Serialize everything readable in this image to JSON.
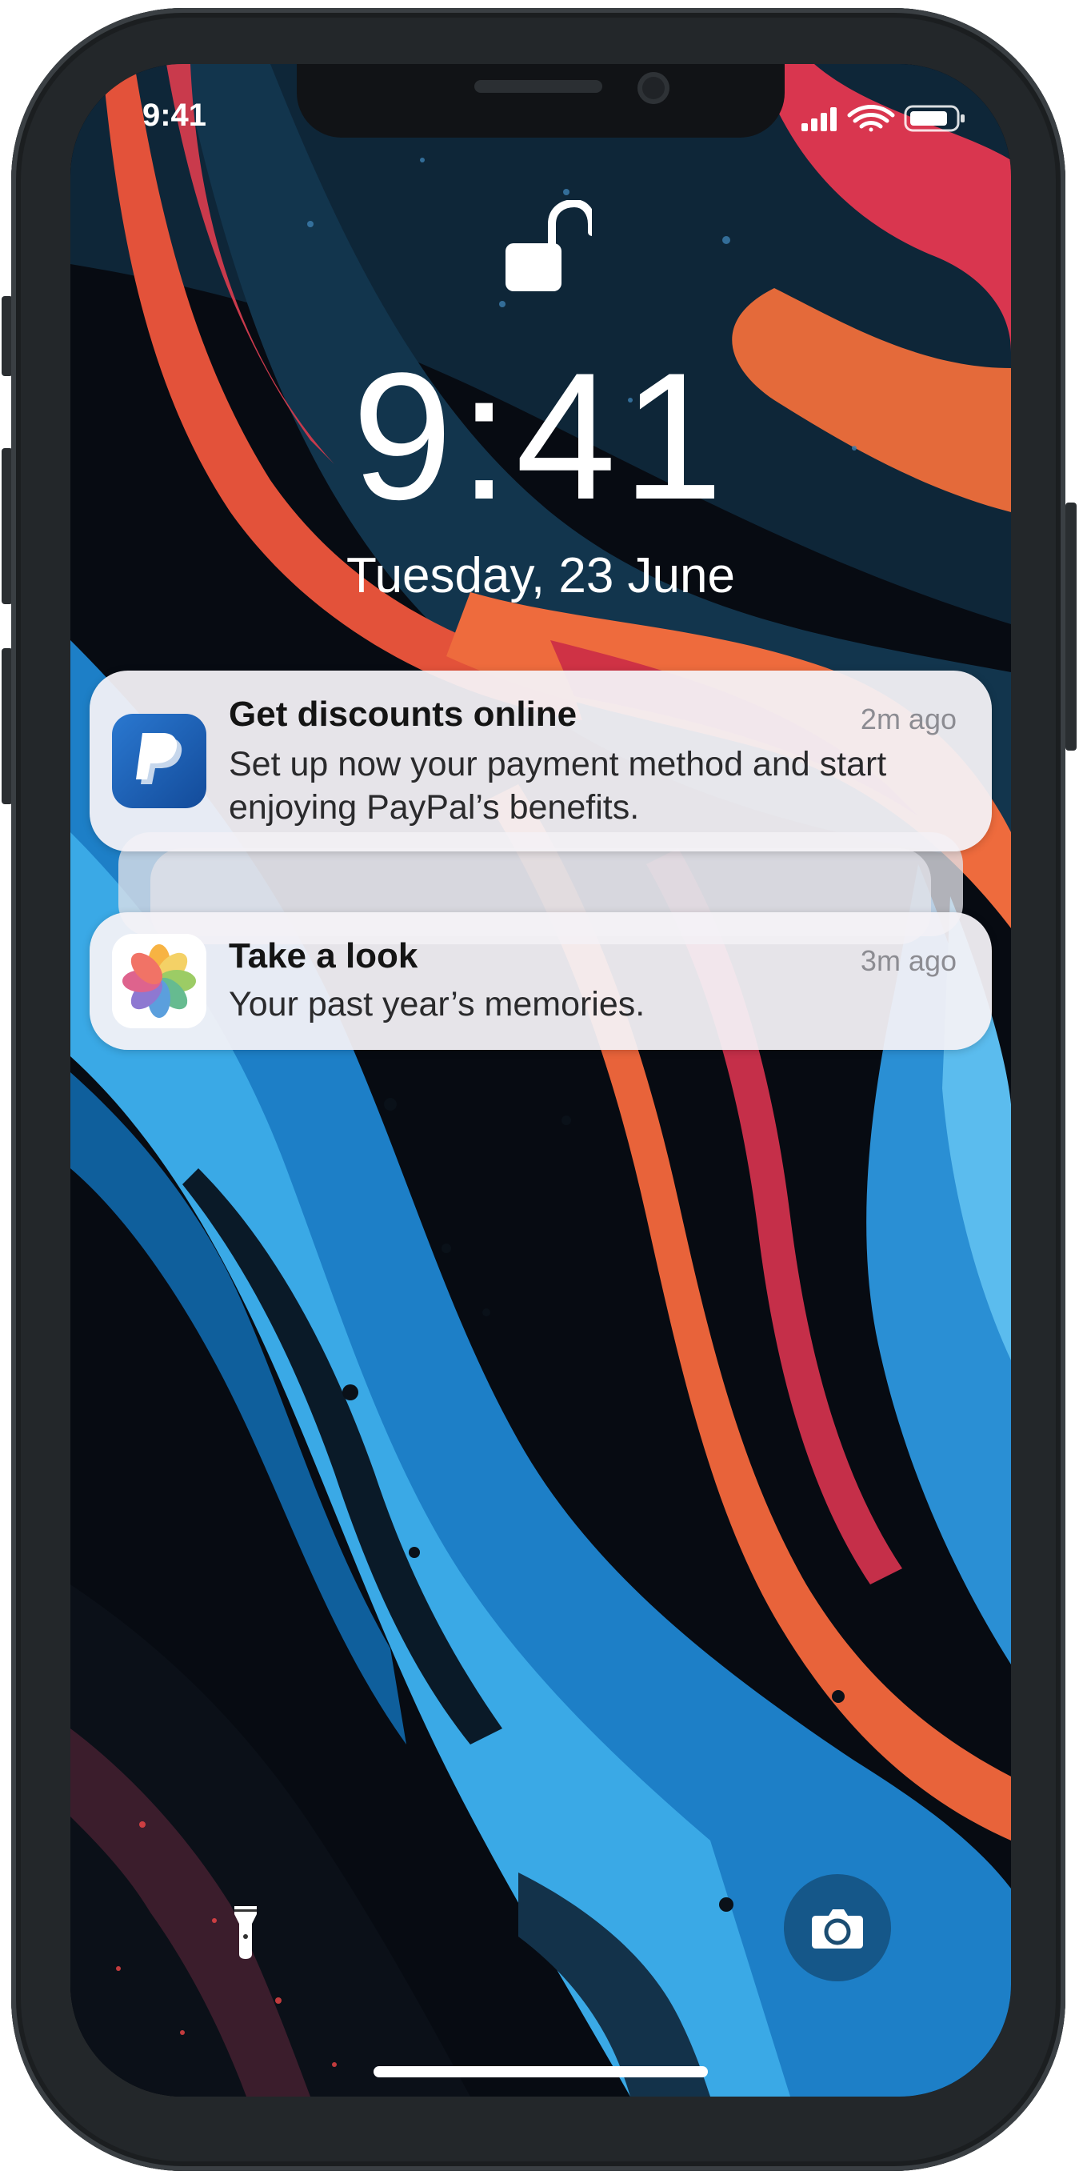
{
  "status_bar": {
    "time": "9:41",
    "signal_icon": "cellular-signal-icon",
    "wifi_icon": "wifi-icon",
    "battery_icon": "battery-icon"
  },
  "lock_screen": {
    "lock_state_icon": "unlocked-padlock-icon",
    "clock": "9:41",
    "date": "Tuesday, 23 June"
  },
  "notifications": [
    {
      "app_icon": "paypal-icon",
      "title": "Get discounts online",
      "time": "2m ago",
      "body_line1": "Set up now your payment method and start",
      "body_line2": "enjoying PayPal’s benefits.",
      "stacked": true
    },
    {
      "app_icon": "photos-icon",
      "title": "Take a look",
      "time": "3m ago",
      "body_line1": "Your past year’s memories.",
      "stacked": false
    }
  ],
  "quick_actions": {
    "left": "flashlight-icon",
    "right": "camera-icon"
  },
  "colors": {
    "paypal_blue": "#1d5eb6",
    "text_primary": "#141414",
    "text_secondary": "#8c8c92"
  }
}
